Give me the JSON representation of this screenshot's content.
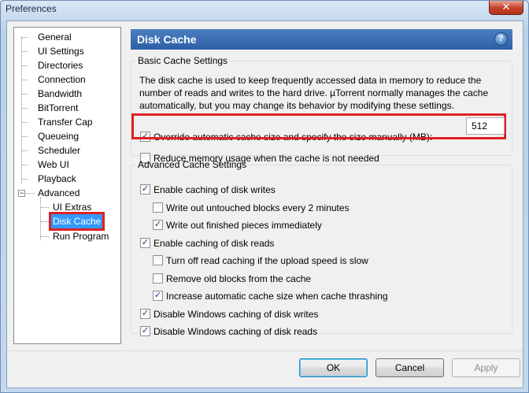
{
  "window": {
    "title": "Preferences",
    "close_glyph": "✕"
  },
  "tree": {
    "items": [
      {
        "label": "General"
      },
      {
        "label": "UI Settings"
      },
      {
        "label": "Directories"
      },
      {
        "label": "Connection"
      },
      {
        "label": "Bandwidth"
      },
      {
        "label": "BitTorrent"
      },
      {
        "label": "Transfer Cap"
      },
      {
        "label": "Queueing"
      },
      {
        "label": "Scheduler"
      },
      {
        "label": "Web UI"
      },
      {
        "label": "Playback"
      },
      {
        "label": "Advanced",
        "expander": "−"
      },
      {
        "label": "UI Extras"
      },
      {
        "label": "Disk Cache",
        "selected": true
      },
      {
        "label": "Run Program"
      }
    ]
  },
  "panel": {
    "title": "Disk Cache",
    "help_glyph": "?"
  },
  "basic": {
    "legend": "Basic Cache Settings",
    "description": "The disk cache is used to keep frequently accessed data in memory to reduce the number of reads and writes to the hard drive. µTorrent normally manages the cache automatically, but you may change its behavior by modifying these settings.",
    "override_label": "Override automatic cache size and specify the size manually (MB):",
    "override_checked": true,
    "size_value": "512",
    "reduce_label": "Reduce memory usage when the cache is not needed",
    "reduce_checked": false
  },
  "advanced": {
    "legend": "Advanced Cache Settings",
    "options": [
      {
        "label": "Enable caching of disk writes",
        "checked": true
      },
      {
        "label": "Write out untouched blocks every 2 minutes",
        "checked": false
      },
      {
        "label": "Write out finished pieces immediately",
        "checked": true
      },
      {
        "label": "Enable caching of disk reads",
        "checked": true
      },
      {
        "label": "Turn off read caching if the upload speed is slow",
        "checked": false
      },
      {
        "label": "Remove old blocks from the cache",
        "checked": false
      },
      {
        "label": "Increase automatic cache size when cache thrashing",
        "checked": true
      },
      {
        "label": "Disable Windows caching of disk writes",
        "checked": true
      },
      {
        "label": "Disable Windows caching of disk reads",
        "checked": true
      }
    ]
  },
  "buttons": {
    "ok": "OK",
    "cancel": "Cancel",
    "apply": "Apply"
  },
  "check_glyph": "✓"
}
